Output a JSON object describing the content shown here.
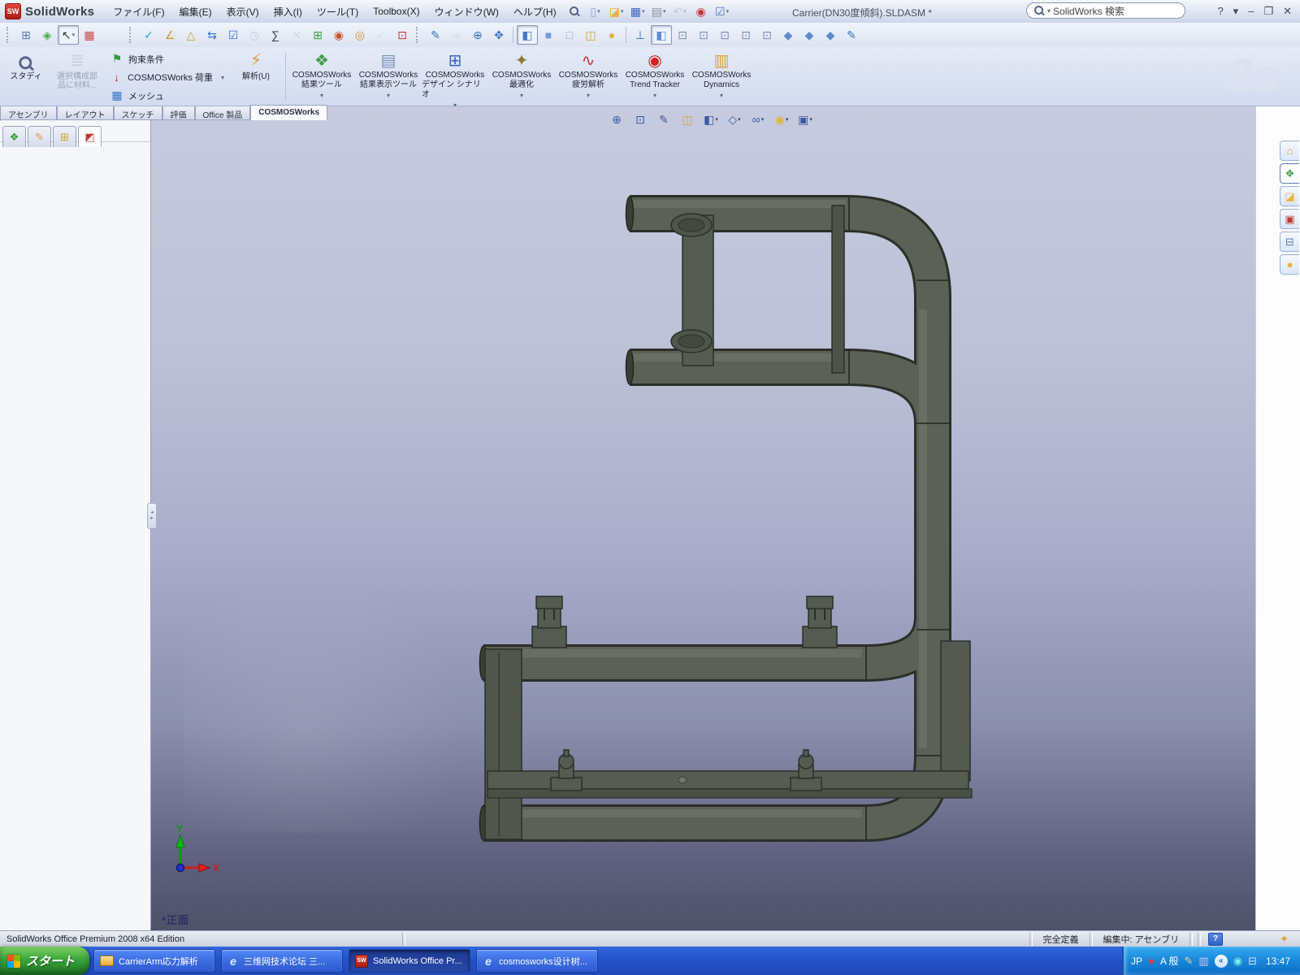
{
  "ui": {
    "caret": "▾"
  },
  "titlebar": {
    "logo_text": "SW",
    "app_name": "SolidWorks",
    "menus": [
      "ファイル(F)",
      "編集(E)",
      "表示(V)",
      "挿入(I)",
      "ツール(T)",
      "Toolbox(X)",
      "ウィンドウ(W)",
      "ヘルプ(H)"
    ],
    "document_title": "Carrier(DN30度傾斜).SLDASM *",
    "search_value": "SolidWorks 検索",
    "window_buttons": [
      {
        "n": "help-button",
        "g": "?"
      },
      {
        "n": "help-caret",
        "g": "▾"
      },
      {
        "n": "minimize-button",
        "g": "–"
      },
      {
        "n": "restore-button",
        "g": "❐"
      },
      {
        "n": "close-button",
        "g": "✕"
      }
    ],
    "standard_icons": [
      {
        "n": "new-document",
        "g": "▯",
        "c": "#8fa3cf",
        "dd": true
      },
      {
        "n": "open",
        "g": "◪",
        "c": "#e8b33a",
        "dd": true
      },
      {
        "n": "save",
        "g": "▦",
        "c": "#3a62c0",
        "dd": true
      },
      {
        "n": "print",
        "g": "▤",
        "c": "#8a93a8",
        "dd": true
      },
      {
        "n": "undo",
        "g": "↶",
        "c": "#9aa2b2",
        "dd": true,
        "dis": true
      },
      {
        "n": "rebuild-traffic-light",
        "g": "◉",
        "c": "#c03a36"
      },
      {
        "n": "options",
        "g": "☑",
        "c": "#4c78c8",
        "dd": true
      }
    ]
  },
  "toolbars": {
    "selection": [
      {
        "n": "split-window",
        "g": "⊞",
        "c": "#5b79b8"
      },
      {
        "n": "assembly-visualization",
        "g": "◈",
        "c": "#3fae49"
      },
      {
        "n": "select-arrow",
        "g": "↖",
        "c": "#30343c",
        "pressed": true,
        "dd": true
      },
      {
        "n": "color-swatches",
        "g": "▦",
        "c": "#c5484a"
      }
    ],
    "tools": [
      {
        "n": "spell-check",
        "g": "✓",
        "c": "#2e9bd6"
      },
      {
        "n": "measure",
        "g": "∠",
        "c": "#c79a2e"
      },
      {
        "n": "mass-properties",
        "g": "△",
        "c": "#caa32f"
      },
      {
        "n": "move-component",
        "g": "⇆",
        "c": "#3a72c4"
      },
      {
        "n": "design-checker",
        "g": "☑",
        "c": "#3a72c4"
      },
      {
        "n": "schedule",
        "g": "◷",
        "c": "#9aa2b2",
        "dis": true
      },
      {
        "n": "equations",
        "g": "∑",
        "c": "#333a45"
      },
      {
        "n": "deviation-analysis",
        "g": "✕",
        "c": "#b9bfca",
        "dis": true
      },
      {
        "n": "bom-table",
        "g": "⊞",
        "c": "#3f9e45"
      },
      {
        "n": "photoworks-render",
        "g": "◉",
        "c": "#c2572e"
      },
      {
        "n": "photoworks-options",
        "g": "◎",
        "c": "#d78f2a"
      },
      {
        "n": "render-last",
        "g": "✓",
        "c": "#c3c9d4",
        "dis": true
      },
      {
        "n": "layer-properties",
        "g": "⊡",
        "c": "#c03a36"
      }
    ],
    "view": [
      {
        "n": "redraw",
        "g": "✎",
        "c": "#3a72c4"
      },
      {
        "n": "link-views",
        "g": "∞",
        "c": "#b9bfca",
        "dis": true
      },
      {
        "n": "zoom-in-out",
        "g": "⊕",
        "c": "#3a72c4"
      },
      {
        "n": "pan",
        "g": "✥",
        "c": "#3a72c4"
      },
      {
        "sep": true
      },
      {
        "n": "shaded-with-edges",
        "g": "◧",
        "c": "#4a77c9",
        "pressed": true
      },
      {
        "n": "shaded",
        "g": "■",
        "c": "#6f9bd8"
      },
      {
        "n": "hidden-lines-removed",
        "g": "□",
        "c": "#8fa3c8"
      },
      {
        "n": "section-view",
        "g": "◫",
        "c": "#d9a43a"
      },
      {
        "n": "realview",
        "g": "●",
        "c": "#e0b53a"
      },
      {
        "sep": true
      },
      {
        "n": "normal-to",
        "g": "⊥",
        "c": "#3a72c4"
      },
      {
        "n": "view-isometric",
        "g": "◧",
        "c": "#5f8cd0",
        "pressed": true
      },
      {
        "n": "view-front",
        "g": "⊡",
        "c": "#7b8db4"
      },
      {
        "n": "view-back",
        "g": "⊡",
        "c": "#7b8db4"
      },
      {
        "n": "view-left",
        "g": "⊡",
        "c": "#7b8db4"
      },
      {
        "n": "view-right",
        "g": "⊡",
        "c": "#7b8db4"
      },
      {
        "n": "view-top",
        "g": "⊡",
        "c": "#7b8db4"
      },
      {
        "n": "view-dimetric",
        "g": "◆",
        "c": "#5f8cd0"
      },
      {
        "n": "view-trimetric",
        "g": "◆",
        "c": "#5f8cd0"
      },
      {
        "n": "view-single",
        "g": "◆",
        "c": "#5f8cd0"
      },
      {
        "n": "view-selector",
        "g": "✎",
        "c": "#3a72c4"
      }
    ]
  },
  "command_manager": {
    "study_label": "スタディ",
    "apply_material_label": "選択構成部品に材料...",
    "stack": [
      {
        "n": "restraints",
        "label": "拘束条件",
        "g": "⚑",
        "c": "#2f9e33"
      },
      {
        "n": "loads",
        "label": "COSMOSWorks 荷重",
        "g": "↓",
        "c": "#cc2222",
        "dd": true
      },
      {
        "n": "mesh",
        "label": "メッシュ",
        "g": "▦",
        "c": "#3a72c4"
      }
    ],
    "run_label": "解析(U)",
    "big_buttons": [
      {
        "n": "results-tools",
        "line1": "COSMOSWorks",
        "line2": "結果ツール",
        "g": "❖",
        "c": "#3f9e45",
        "dd": true
      },
      {
        "n": "plot-tools",
        "line1": "COSMOSWorks",
        "line2": "結果表示ツール",
        "g": "▤",
        "c": "#7b8db4",
        "dd": true
      },
      {
        "n": "design-scenario",
        "line1": "COSMOSWorks",
        "line2": "デザイン シナリオ",
        "g": "⊞",
        "c": "#3a62c0",
        "dd": true
      },
      {
        "n": "optimization",
        "line1": "COSMOSWorks",
        "line2": "最適化",
        "g": "✦",
        "c": "#8a7a3a",
        "dd": true
      },
      {
        "n": "fatigue",
        "line1": "COSMOSWorks",
        "line2": "疲労解析",
        "g": "∿",
        "c": "#c03a36",
        "dd": true
      },
      {
        "n": "trend-tracker",
        "line1": "COSMOSWorks",
        "line2": "Trend Tracker",
        "g": "◉",
        "c": "#cc2222",
        "dd": true
      },
      {
        "n": "dynamics",
        "line1": "COSMOSWorks",
        "line2": "Dynamics",
        "g": "▥",
        "c": "#d9a43a",
        "dd": true
      }
    ],
    "tabs": [
      {
        "n": "tab-assembly",
        "label": "アセンブリ"
      },
      {
        "n": "tab-layout",
        "label": "レイアウト"
      },
      {
        "n": "tab-sketch",
        "label": "スケッチ"
      },
      {
        "n": "tab-evaluate",
        "label": "評価"
      },
      {
        "n": "tab-office",
        "label": "Office 製品"
      },
      {
        "n": "tab-cosmosworks",
        "label": "COSMOSWorks",
        "active": true
      }
    ],
    "watermark": "3s"
  },
  "panel_tabs": [
    {
      "n": "feature-manager-tab",
      "g": "❖",
      "c": "#2f9e33"
    },
    {
      "n": "property-manager-tab",
      "g": "✎",
      "c": "#e8903a"
    },
    {
      "n": "configuration-manager-tab",
      "g": "⊞",
      "c": "#caa32f"
    },
    {
      "n": "cosmosworks-manager-tab",
      "g": "◩",
      "c": "#c03a36",
      "active": true
    }
  ],
  "headsup": [
    {
      "n": "zoom-to-fit",
      "g": "⊕",
      "c": "#3c5a9e"
    },
    {
      "n": "zoom-to-area",
      "g": "⊡",
      "c": "#3c5a9e"
    },
    {
      "n": "previous-view",
      "g": "✎",
      "c": "#3c5a9e"
    },
    {
      "n": "section-view",
      "g": "◫",
      "c": "#d9a43a"
    },
    {
      "n": "view-orientation",
      "g": "◧",
      "c": "#3c5a9e",
      "dd": true
    },
    {
      "n": "display-style",
      "g": "◇",
      "c": "#3c5a9e",
      "dd": true
    },
    {
      "n": "hide-show-items",
      "g": "∞",
      "c": "#3c5a9e",
      "dd": true
    },
    {
      "n": "edit-appearance",
      "g": "◉",
      "c": "#e0b53a",
      "dd": true
    },
    {
      "n": "apply-scene",
      "g": "▣",
      "c": "#3c5a9e",
      "dd": true
    }
  ],
  "taskpane": [
    {
      "n": "solidworks-resources",
      "g": "⌂",
      "c": "#d9a43a"
    },
    {
      "n": "design-library",
      "g": "❖",
      "c": "#3f9e45",
      "active": true
    },
    {
      "n": "file-explorer",
      "g": "◪",
      "c": "#e8b33a"
    },
    {
      "n": "solidworks-toolbox",
      "g": "▣",
      "c": "#c03a36"
    },
    {
      "n": "view-palette",
      "g": "⊟",
      "c": "#5b79b8"
    },
    {
      "n": "appearances",
      "g": "●",
      "c": "#e0b53a"
    }
  ],
  "viewport": {
    "view_label": "*正面",
    "triad": {
      "x": "X",
      "y": "Y"
    }
  },
  "status_bar": {
    "product": "SolidWorks Office Premium 2008 x64 Edition",
    "constraint_status": "完全定義",
    "editing_status": "編集中: アセンブリ",
    "help_glyph": "?",
    "tag_glyph": "✦"
  },
  "taskbar": {
    "start_label": "スタート",
    "tasks": [
      {
        "n": "task-carrierarm-folder",
        "icon": "folder",
        "label": "CarrierArm応力解析"
      },
      {
        "n": "task-ie-forum",
        "icon": "ie",
        "ig": "e",
        "label": "三维网技术论坛 三..."
      },
      {
        "n": "task-solidworks",
        "icon": "sw",
        "ig": "SW",
        "label": "SolidWorks Office Pr...",
        "active": true
      },
      {
        "n": "task-ie-cosmosworks",
        "icon": "ie",
        "ig": "e",
        "label": "cosmosworks设计树..."
      }
    ],
    "tray": {
      "lang": "JP",
      "ime_mode": "A 般",
      "time": "13:47"
    }
  }
}
